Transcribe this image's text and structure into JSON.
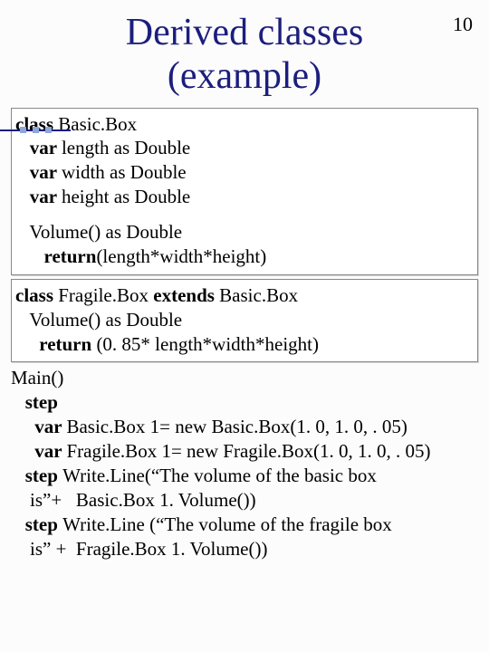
{
  "page_number": "10",
  "title_line1": "Derived classes",
  "title_line2": "(example)",
  "box1": {
    "l1_a": "class ",
    "l1_b": "Basic.Box",
    "l2_a": "   var ",
    "l2_b": "length as Double",
    "l3_a": "   var ",
    "l3_b": "width as Double",
    "l4_a": "   var ",
    "l4_b": "height as Double",
    "l5": "   Volume() as Double",
    "l6_a": "      return",
    "l6_b": "(length*width*height)"
  },
  "box2": {
    "l1_a": "class ",
    "l1_b": "Fragile.Box ",
    "l1_c": "extends ",
    "l1_d": "Basic.Box",
    "l2": "   Volume() as Double",
    "l3_a": "     return ",
    "l3_b": "(0. 85* length*width*height)"
  },
  "main": {
    "m1": "Main()",
    "m2": "   step",
    "m3_a": "     var ",
    "m3_b": "Basic.Box 1= new Basic.Box(1. 0, 1. 0, . 05)",
    "m4_a": "     var ",
    "m4_b": "Fragile.Box 1= new Fragile.Box(1. 0, 1. 0, . 05)",
    "m5_a": "   step ",
    "m5_b": "Write.Line(“The volume of the basic box",
    "m6": "    is”+   Basic.Box 1. Volume())",
    "m7_a": "   step ",
    "m7_b": "Write.Line (“The volume of the fragile box",
    "m8": "    is” +  Fragile.Box 1. Volume())"
  }
}
